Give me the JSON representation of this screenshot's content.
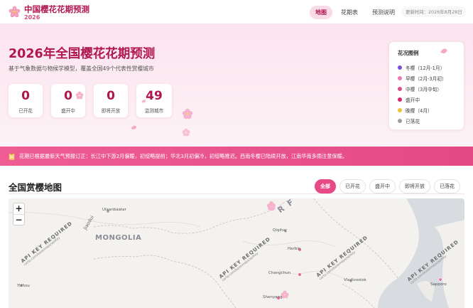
{
  "header": {
    "title": "中国樱花花期预测",
    "year": "2026",
    "nav": [
      {
        "label": "地图",
        "active": true
      },
      {
        "label": "花期表",
        "active": false
      },
      {
        "label": "预测说明",
        "active": false
      }
    ],
    "updated": "更新时间：2026年8月28日"
  },
  "hero": {
    "title": "2026年全国樱花花期预测",
    "subtitle": "基于气象数据与物候学模型，覆盖全国49个代表性赏樱城市",
    "stats": [
      {
        "value": "0",
        "label": "已开花"
      },
      {
        "value": "0",
        "label": "盛开中"
      },
      {
        "value": "0",
        "label": "即将开放"
      },
      {
        "value": "49",
        "label": "监测城市"
      }
    ]
  },
  "legend": {
    "title": "花况图例",
    "items": [
      {
        "label": "冬樱（12月-1月）",
        "color": "#7b4fd6"
      },
      {
        "label": "早樱（2月-3月初）",
        "color": "#ef77b6"
      },
      {
        "label": "中樱（3月中旬）",
        "color": "#d9508f"
      },
      {
        "label": "盛开中",
        "color": "#d6276d"
      },
      {
        "label": "晚樱（4月）",
        "color": "#e9c23d"
      },
      {
        "label": "已落花",
        "color": "#9e9e9e"
      }
    ]
  },
  "notice": {
    "icon": "clipboard-icon",
    "text": "花期已根据最新天气预报订正：长江中下游2月偏暖，初绽略提前；华北3月初偏冷，初绽略推迟。西南冬樱已陆续开放，江南华南多雨注意保暖。"
  },
  "map_section": {
    "title": "全国赏樱地图",
    "filters": [
      {
        "label": "全部",
        "active": true
      },
      {
        "label": "已开花",
        "active": false
      },
      {
        "label": "盛开中",
        "active": false
      },
      {
        "label": "即将开放",
        "active": false
      },
      {
        "label": "已落花",
        "active": false
      }
    ],
    "zoom_in": "+",
    "zoom_out": "−",
    "country_label": "MONGOLIA",
    "partial_label": "R F",
    "watermark": "API KEY REQUIRED",
    "watermark_url": "carto.com/basemaps/apikey",
    "places": [
      "Qiqihar",
      "Harbin",
      "Changchun",
      "Vladivostok",
      "Shenyang",
      "Sapporo",
      "Yizhou",
      "Ulaanbaatar",
      "Jiaodui"
    ]
  },
  "colors": {
    "brand": "#b0174f",
    "accent": "#e84a86",
    "hero_bg": "#fbe4ee"
  }
}
